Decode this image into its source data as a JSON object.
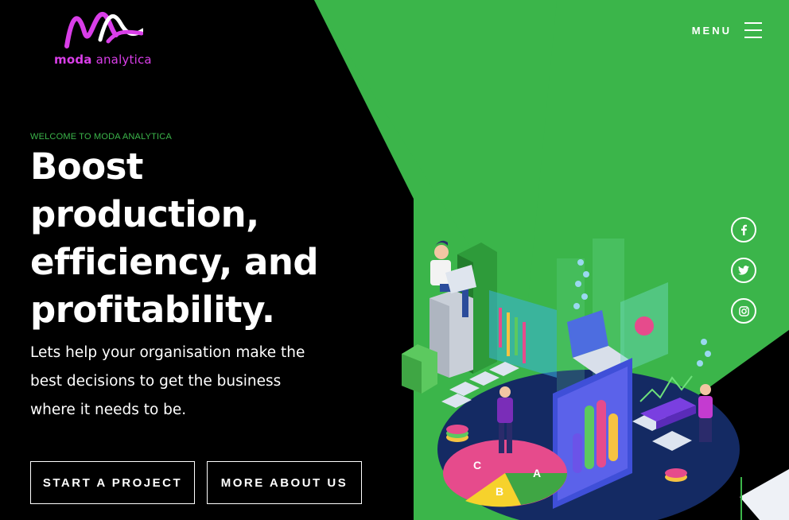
{
  "brand": {
    "name_bold": "moda",
    "name_light": " analytica",
    "logo_color": "#d93ee8",
    "accent": "#3bb54a"
  },
  "nav": {
    "menu_label": "MENU"
  },
  "hero": {
    "eyebrow": "WELCOME TO MODA ANALYTICA",
    "headline_lines": [
      "Boost",
      "production,",
      "efficiency, and",
      "profitability."
    ],
    "subtext_lines": [
      "Lets help your organisation make the",
      "best decisions to get the business",
      "where it needs to be."
    ],
    "buttons": {
      "start": "START A PROJECT",
      "more": "MORE ABOUT US"
    }
  },
  "social": [
    {
      "name": "facebook",
      "icon": "facebook-icon"
    },
    {
      "name": "twitter",
      "icon": "twitter-icon"
    },
    {
      "name": "instagram",
      "icon": "instagram-icon"
    }
  ],
  "illustration": {
    "pie_labels": [
      "C",
      "A",
      "B"
    ]
  }
}
